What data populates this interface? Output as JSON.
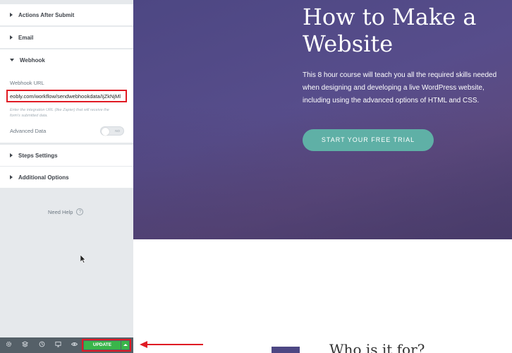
{
  "sidebar": {
    "sections": [
      {
        "label": "Actions After Submit",
        "expanded": false
      },
      {
        "label": "Email",
        "expanded": false
      },
      {
        "label": "Webhook",
        "expanded": true
      },
      {
        "label": "Steps Settings",
        "expanded": false
      },
      {
        "label": "Additional Options",
        "expanded": false
      }
    ],
    "webhook": {
      "url_label": "Webhook URL",
      "url_value": "eobly.com/workflow/sendwebhookdata/IjZkNjMl",
      "help_text": "Enter the integration URL (like Zapier) that will receive the form's submitted data.",
      "advanced_label": "Advanced Data",
      "advanced_toggle": "NO"
    },
    "need_help": "Need Help",
    "help_icon": "?"
  },
  "bottombar": {
    "icons": [
      "gear-icon",
      "layers-icon",
      "history-icon",
      "desktop-icon",
      "eye-icon"
    ],
    "update_label": "UPDATE"
  },
  "preview": {
    "hero_title": "How to Make a Website",
    "hero_desc": "This 8 hour course will teach you all the required skills needed when designing and developing a live WordPress website, including using the advanced options of HTML and CSS.",
    "cta_label": "START YOUR FREE TRIAL",
    "section_title": "Who is it for?"
  },
  "colors": {
    "annotation": "#e01b24",
    "update_green": "#39b54a",
    "cta": "#5fb0a6",
    "hero": "#4d4783"
  }
}
